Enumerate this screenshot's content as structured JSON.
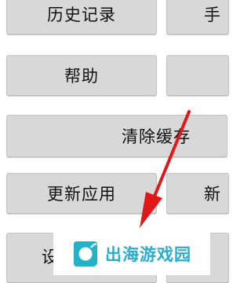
{
  "buttons": {
    "history": "历史记录",
    "top_right_partial": "手",
    "help": "帮助",
    "clear_cache": "清除缓存",
    "update_app": "更新应用",
    "lower_right_partial": "新",
    "settings_partial": "设"
  },
  "watermark": {
    "text": "出海游戏园"
  },
  "colors": {
    "button_bg": "#d8d8d8",
    "arrow": "#e01818",
    "watermark_text": "#2aaed0"
  }
}
